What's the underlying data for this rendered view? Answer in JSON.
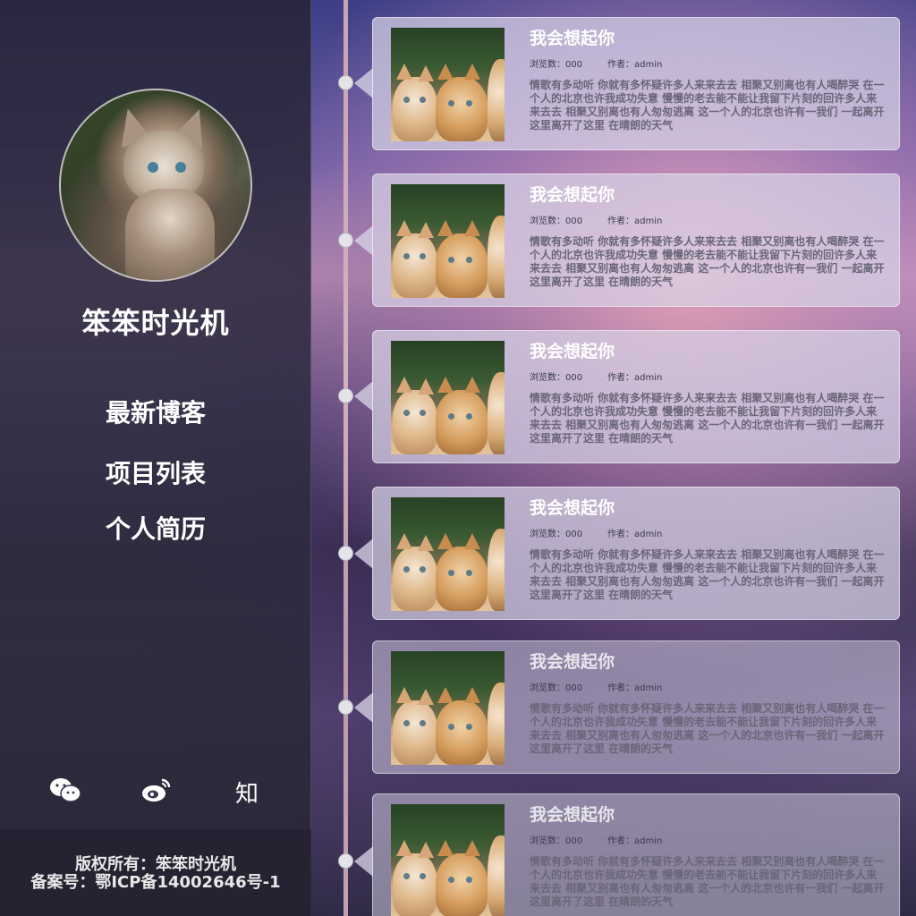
{
  "sidebar": {
    "site_title": "笨笨时光机",
    "nav": [
      {
        "label": "最新博客"
      },
      {
        "label": "项目列表"
      },
      {
        "label": "个人简历"
      }
    ],
    "social": [
      {
        "name": "wechat-icon",
        "glyph": "✉"
      },
      {
        "name": "weibo-icon",
        "glyph": "◉"
      },
      {
        "name": "zhihu-icon",
        "glyph": "知"
      }
    ],
    "footer": {
      "copyright": "版权所有：笨笨时光机",
      "icp": "备案号：鄂ICP备14002646号-1"
    }
  },
  "posts": [
    {
      "title": "我会想起你",
      "views_label": "浏览数：000",
      "author_label": "作者：admin",
      "body": "情歌有多动听 你就有多怀疑许多人来来去去 相聚又别离也有人喝醉哭 在一个人的北京也许我成功失意 慢慢的老去能不能让我留下片刻的回许多人来来去去 相聚又别离也有人匆匆逃离 这一个人的北京也许有一我们 一起离开这里离开了这里 在晴朗的天气"
    },
    {
      "title": "我会想起你",
      "views_label": "浏览数：000",
      "author_label": "作者：admin",
      "body": "情歌有多动听 你就有多怀疑许多人来来去去 相聚又别离也有人喝醉哭 在一个人的北京也许我成功失意 慢慢的老去能不能让我留下片刻的回许多人来来去去 相聚又别离也有人匆匆逃离 这一个人的北京也许有一我们 一起离开这里离开了这里 在晴朗的天气"
    },
    {
      "title": "我会想起你",
      "views_label": "浏览数：000",
      "author_label": "作者：admin",
      "body": "情歌有多动听 你就有多怀疑许多人来来去去 相聚又别离也有人喝醉哭 在一个人的北京也许我成功失意 慢慢的老去能不能让我留下片刻的回许多人来来去去 相聚又别离也有人匆匆逃离 这一个人的北京也许有一我们 一起离开这里离开了这里 在晴朗的天气"
    },
    {
      "title": "我会想起你",
      "views_label": "浏览数：000",
      "author_label": "作者：admin",
      "body": "情歌有多动听 你就有多怀疑许多人来来去去 相聚又别离也有人喝醉哭 在一个人的北京也许我成功失意 慢慢的老去能不能让我留下片刻的回许多人来来去去 相聚又别离也有人匆匆逃离 这一个人的北京也许有一我们 一起离开这里离开了这里 在晴朗的天气"
    },
    {
      "title": "我会想起你",
      "views_label": "浏览数：000",
      "author_label": "作者：admin",
      "body": "情歌有多动听 你就有多怀疑许多人来来去去 相聚又别离也有人喝醉哭 在一个人的北京也许我成功失意 慢慢的老去能不能让我留下片刻的回许多人来来去去 相聚又别离也有人匆匆逃离 这一个人的北京也许有一我们 一起离开这里离开了这里 在晴朗的天气"
    },
    {
      "title": "我会想起你",
      "views_label": "浏览数：000",
      "author_label": "作者：admin",
      "body": "情歌有多动听 你就有多怀疑许多人来来去去 相聚又别离也有人喝醉哭 在一个人的北京也许我成功失意 慢慢的老去能不能让我留下片刻的回许多人来来去去 相聚又别离也有人匆匆逃离 这一个人的北京也许有一我们 一起离开这里离开了这里 在晴朗的天气"
    }
  ]
}
